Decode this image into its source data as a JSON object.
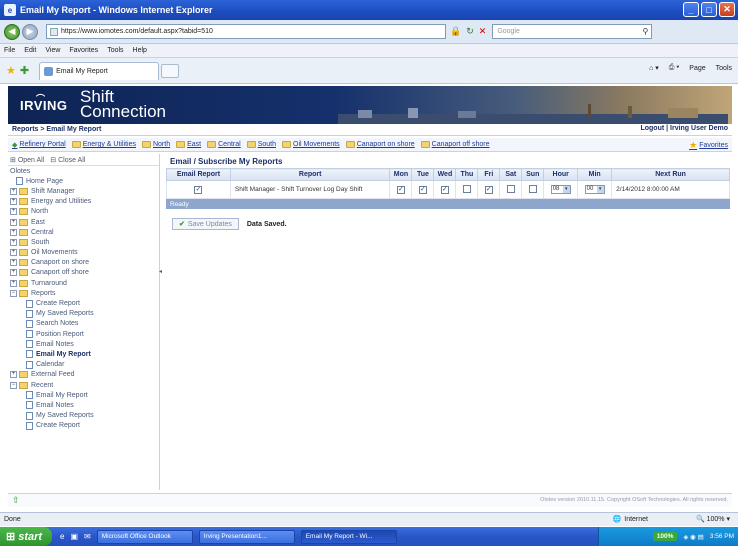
{
  "window": {
    "title": "Email My Report - Windows Internet Explorer"
  },
  "address": {
    "url": "https://www.iomotes.com/default.aspx?tabid=510",
    "search_placeholder": "Google"
  },
  "menu": [
    "File",
    "Edit",
    "View",
    "Favorites",
    "Tools",
    "Help"
  ],
  "browser_tab": {
    "label": "Email My Report"
  },
  "toolbar_right": {
    "page": "Page",
    "tools": "Tools"
  },
  "banner": {
    "brand": "IRVING",
    "product_line1": "Shift",
    "product_line2": "Connection"
  },
  "breadcrumb": "Reports > Email My Report",
  "user_links": "Logout | Irving User Demo",
  "nav_links": [
    "Refinery Portal",
    "Energy & Utilities",
    "North",
    "East",
    "Central",
    "South",
    "Oil Movements",
    "Canaport on shore",
    "Canaport off shore"
  ],
  "favorites_label": "Favorites",
  "sidebar": {
    "open_all": "Open All",
    "close_all": "Close All",
    "root": "Olotes",
    "items": [
      {
        "label": "Home Page",
        "type": "doc",
        "level": 1
      },
      {
        "label": "Shift Manager",
        "type": "folder",
        "level": 0
      },
      {
        "label": "Energy and Utilities",
        "type": "folder",
        "level": 0
      },
      {
        "label": "North",
        "type": "folder",
        "level": 0
      },
      {
        "label": "East",
        "type": "folder",
        "level": 0
      },
      {
        "label": "Central",
        "type": "folder",
        "level": 0
      },
      {
        "label": "South",
        "type": "folder",
        "level": 0
      },
      {
        "label": "Oil Movements",
        "type": "folder",
        "level": 0
      },
      {
        "label": "Canaport on shore",
        "type": "folder",
        "level": 0
      },
      {
        "label": "Canaport off shore",
        "type": "folder",
        "level": 0
      },
      {
        "label": "Turnaround",
        "type": "folder",
        "level": 0
      },
      {
        "label": "Reports",
        "type": "folder-open",
        "level": 0
      },
      {
        "label": "Create Report",
        "type": "doc",
        "level": 2
      },
      {
        "label": "My Saved Reports",
        "type": "doc",
        "level": 2
      },
      {
        "label": "Search Notes",
        "type": "doc",
        "level": 2
      },
      {
        "label": "Position Report",
        "type": "doc",
        "level": 2
      },
      {
        "label": "Email Notes",
        "type": "doc",
        "level": 2
      },
      {
        "label": "Email My Report",
        "type": "doc",
        "level": 2,
        "selected": true
      },
      {
        "label": "Calendar",
        "type": "doc",
        "level": 2
      },
      {
        "label": "External Feed",
        "type": "folder",
        "level": 0
      },
      {
        "label": "Recent",
        "type": "folder-open",
        "level": 0
      },
      {
        "label": "Email My Report",
        "type": "doc",
        "level": 2
      },
      {
        "label": "Email Notes",
        "type": "doc",
        "level": 2
      },
      {
        "label": "My Saved Reports",
        "type": "doc",
        "level": 2
      },
      {
        "label": "Create Report",
        "type": "doc",
        "level": 2
      }
    ]
  },
  "main": {
    "title": "Email / Subscribe My Reports",
    "columns": [
      "Email Report",
      "Report",
      "Mon",
      "Tue",
      "Wed",
      "Thu",
      "Fri",
      "Sat",
      "Sun",
      "Hour",
      "Min",
      "Next Run"
    ],
    "row": {
      "email": true,
      "report": "Shift Manager - Shift Turnover Log Day Shift",
      "days": [
        true,
        true,
        true,
        false,
        true,
        false,
        false
      ],
      "hour": "08",
      "min": "00",
      "next_run": "2/14/2012 8:00:00 AM"
    },
    "status": "Ready",
    "save_label": "Save Updates",
    "saved_message": "Data Saved."
  },
  "footer": {
    "copyright": "Olotes version 2010.11.15. Copyright OSoft Technologies. All rights reserved."
  },
  "statusbar": {
    "left": "Done",
    "zone": "Internet",
    "zoom": "100%"
  },
  "taskbar": {
    "start": "start",
    "tasks": [
      "Microsoft Office Outlook",
      "Irving Presentation1...",
      "Email My Report - Wi..."
    ],
    "tray_pct": "100%",
    "clock": "3:56 PM"
  }
}
